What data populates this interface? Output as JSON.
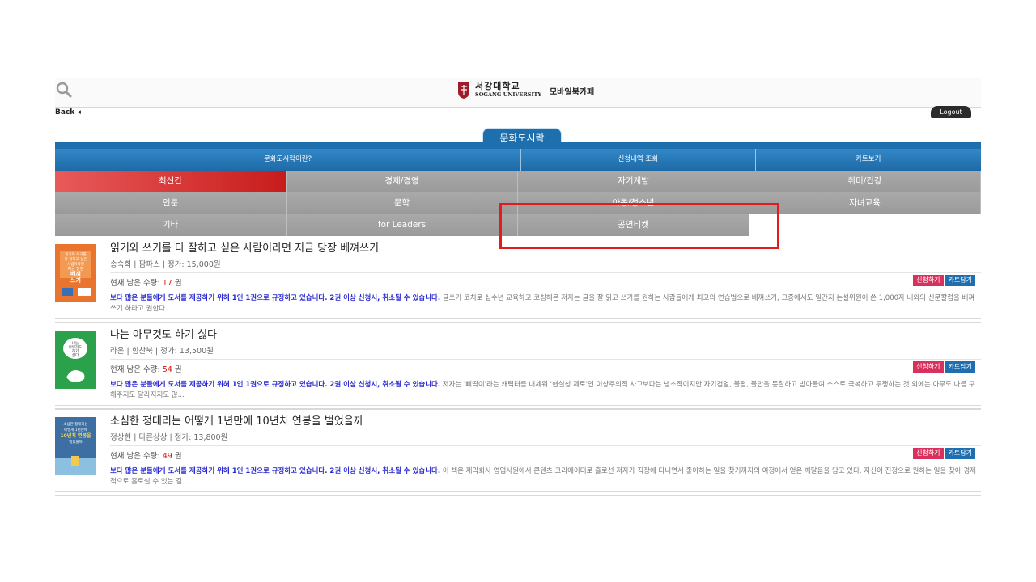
{
  "header": {
    "search_icon": "search-icon",
    "logo_kr": "서강대학교",
    "logo_en": "SOGANG UNIVERSITY",
    "logo_sub": "모바일북카페",
    "brand_color": "#a01c2a"
  },
  "nav": {
    "back": "Back ◂",
    "logout": "Logout",
    "section_title": "문화도시락"
  },
  "top_menu": [
    "문화도시락이란?",
    "신청내역 조회",
    "카트보기"
  ],
  "categories": [
    [
      "최신간",
      "경제/경영",
      "자기계발",
      "취미/건강"
    ],
    [
      "인문",
      "문학",
      "아동/청소년",
      "자녀교육"
    ],
    [
      "기타",
      "for Leaders",
      "공연티켓",
      ""
    ]
  ],
  "active_category": "최신간",
  "colors": {
    "accent_blue": "#1d6fae",
    "active_red": "#d42a2a",
    "apply_pink": "#d9315e",
    "highlight_red": "#e41b1b"
  },
  "buttons": {
    "apply": "신청하기",
    "cart": "카트담기"
  },
  "books": [
    {
      "title": "읽기와 쓰기를 다 잘하고 싶은 사람이라면 지금 당장 베껴쓰기",
      "meta": "송숙희 | 팜파스 | 정가: 15,000원",
      "stock_label": "현재 남은 수량: ",
      "stock": "17",
      "stock_unit": " 권",
      "notice": "보다 많은 분들에게 도서를 제공하기 위해 1인 1권으로 규정하고 있습니다. 2권 이상 신청시, 취소될 수 있습니다.",
      "description": " 글쓰기 코치로 십수년 교육하고 코칭해온 저자는 글을 잘 읽고 쓰기를 원하는 사람들에게 최고의 연습법으로 베껴쓰기, 그중에서도 일간지 논설위원이 쓴 1,000자 내외의 신문칼럼을 베껴쓰기 하라고 권한다.",
      "cover_color": "#e8742e",
      "cover_text": [
        "읽기와 쓰기를",
        "다 잘하고 싶은",
        "사람이라면",
        "지금 당장",
        "베껴",
        "쓰기"
      ]
    },
    {
      "title": "나는 아무것도 하기 싫다",
      "meta": "라온 | 힘찬북 | 정가: 13,500원",
      "stock_label": "현재 남은 수량: ",
      "stock": "54",
      "stock_unit": " 권",
      "notice": "보다 많은 분들에게 도서를 제공하기 위해 1인 1권으로 규정하고 있습니다. 2권 이상 신청시, 취소될 수 있습니다.",
      "description": " 저자는 '삐딱이'라는 캐릭터를 내세워 '현실성 제로'인 이상주의적 사고보다는 냉소적이지만 자기검열, 불평, 불만을 통찰하고 받아들여 스스로 극복하고 투쟁하는 것 외에는 아무도 나를 구해주지도 달라지지도 않...",
      "cover_color": "#2aa14a",
      "cover_text": [
        "나는",
        "아무것도",
        "하기",
        "싫다"
      ]
    },
    {
      "title": "소심한 정대리는 어떻게 1년만에 10년치 연봉을 벌었을까",
      "meta": "정상현 | 다른상상 | 정가: 13,800원",
      "stock_label": "현재 남은 수량: ",
      "stock": "49",
      "stock_unit": " 권",
      "notice": "보다 많은 분들에게 도서를 제공하기 위해 1인 1권으로 규정하고 있습니다. 2권 이상 신청시, 취소될 수 있습니다.",
      "description": " 이 책은 제약회사 영업사원에서 콘텐츠 크리에이터로 홀로선 저자가 직장에 다니면서 좋아하는 일을 찾기까지의 여정에서 얻은 깨달음을 담고 있다. 자신이 진정으로 원하는 일을 찾아 경제적으로 홀로설 수 있는 길...",
      "cover_color": "#3d6fa3",
      "cover_text": [
        "소심한 정대리는",
        "어떻게 1년만에",
        "10년치 연봉을",
        "벌었을까"
      ]
    }
  ]
}
